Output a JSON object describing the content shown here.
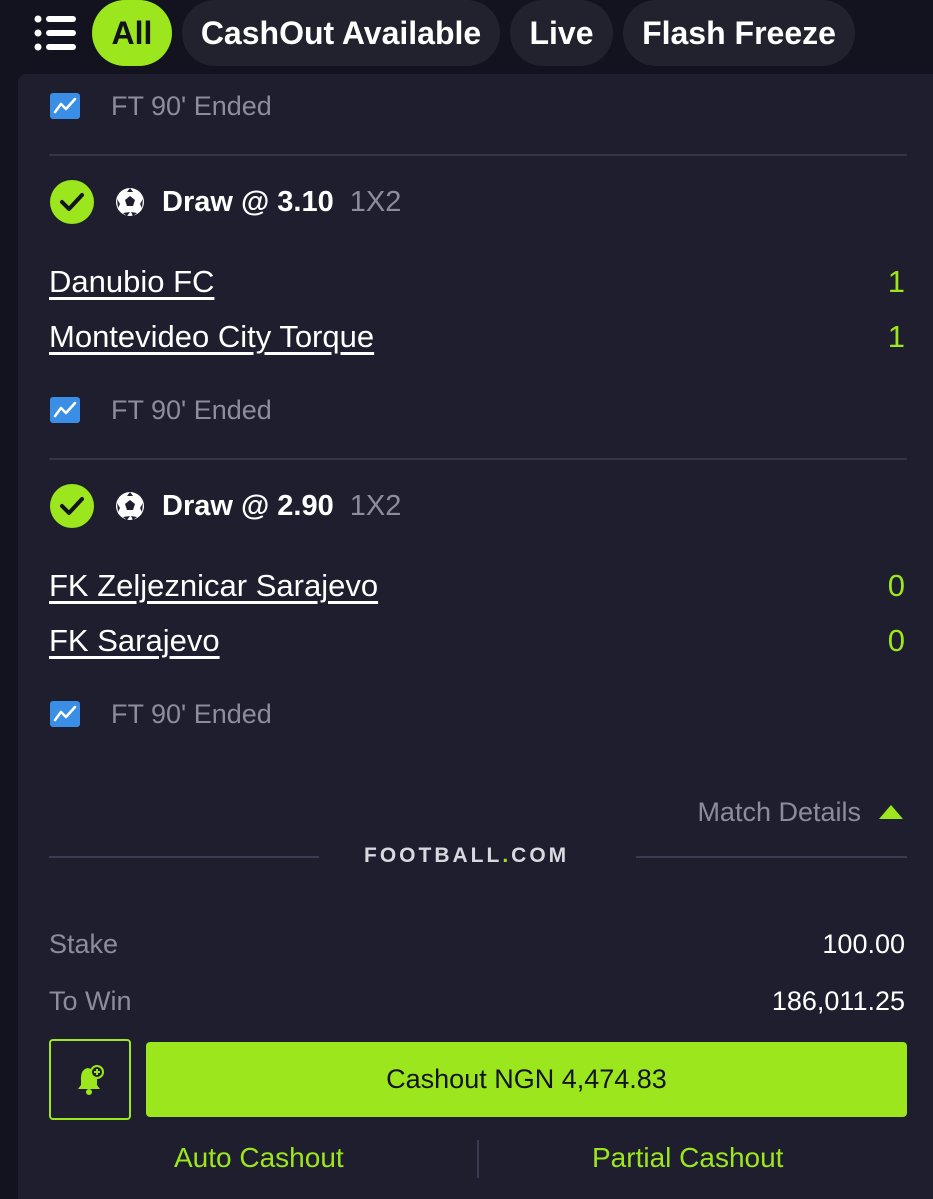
{
  "filters": {
    "menu_icon": "hamburger-list-icon",
    "tabs": [
      {
        "label": "All",
        "active": true
      },
      {
        "label": "CashOut Available",
        "active": false
      },
      {
        "label": "Live",
        "active": false
      },
      {
        "label": "Flash Freeze",
        "active": false
      }
    ]
  },
  "bet": {
    "top_status": "FT 90' Ended",
    "selections": [
      {
        "pick": "Draw @ 3.10",
        "market": "1X2",
        "home_team": "Danubio FC",
        "home_score": "1",
        "away_team": "Montevideo City Torque",
        "away_score": "1",
        "status": "FT 90' Ended"
      },
      {
        "pick": "Draw @ 2.90",
        "market": "1X2",
        "home_team": "FK Zeljeznicar Sarajevo",
        "home_score": "0",
        "away_team": "FK Sarajevo",
        "away_score": "0",
        "status": "FT 90' Ended"
      }
    ],
    "match_details_label": "Match Details",
    "brand_left": "FOOTBALL",
    "brand_dot": ".",
    "brand_right": "COM",
    "stake_label": "Stake",
    "stake_value": "100.00",
    "to_win_label": "To Win",
    "to_win_value": "186,011.25",
    "cashout_label": "Cashout NGN 4,474.83",
    "auto_cashout_label": "Auto Cashout",
    "partial_cashout_label": "Partial Cashout"
  },
  "colors": {
    "accent": "#9be61c",
    "background": "#13131f",
    "card": "#1e1e2e",
    "muted_text": "#8c8c9c",
    "stats_icon": "#3a8ee6"
  }
}
